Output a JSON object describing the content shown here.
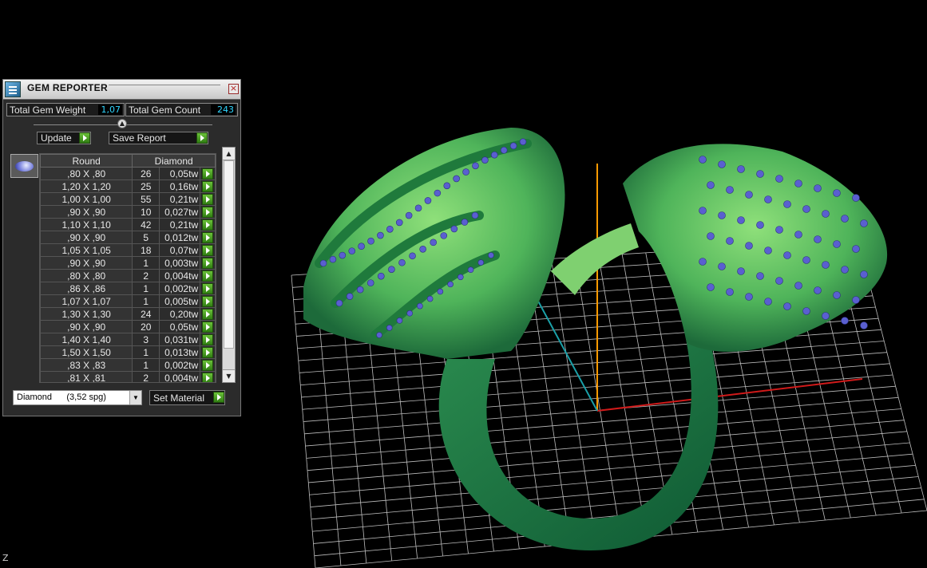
{
  "axis_label": "Z",
  "panel": {
    "title": "GEM REPORTER",
    "close_glyph": "×",
    "total_weight_label": "Total Gem Weight",
    "total_weight_value": "1,07",
    "total_count_label": "Total Gem Count",
    "total_count_value": "243",
    "update_label": "Update",
    "save_label": "Save Report",
    "table": {
      "col_shape": "Round",
      "col_material": "Diamond",
      "rows": [
        {
          "size": ",80 X ,80",
          "count": "26",
          "weight": "0,05tw"
        },
        {
          "size": "1,20 X 1,20",
          "count": "25",
          "weight": "0,16tw"
        },
        {
          "size": "1,00 X 1,00",
          "count": "55",
          "weight": "0,21tw"
        },
        {
          "size": ",90 X ,90",
          "count": "10",
          "weight": "0,027tw"
        },
        {
          "size": "1,10 X 1,10",
          "count": "42",
          "weight": "0,21tw"
        },
        {
          "size": ",90 X ,90",
          "count": "5",
          "weight": "0,012tw"
        },
        {
          "size": "1,05 X 1,05",
          "count": "18",
          "weight": "0,07tw"
        },
        {
          "size": ",90 X ,90",
          "count": "1",
          "weight": "0,003tw"
        },
        {
          "size": ",80 X ,80",
          "count": "2",
          "weight": "0,004tw"
        },
        {
          "size": ",86 X ,86",
          "count": "1",
          "weight": "0,002tw"
        },
        {
          "size": "1,07 X 1,07",
          "count": "1",
          "weight": "0,005tw"
        },
        {
          "size": "1,30 X 1,30",
          "count": "24",
          "weight": "0,20tw"
        },
        {
          "size": ",90 X ,90",
          "count": "20",
          "weight": "0,05tw"
        },
        {
          "size": "1,40 X 1,40",
          "count": "3",
          "weight": "0,031tw"
        },
        {
          "size": "1,50 X 1,50",
          "count": "1",
          "weight": "0,013tw"
        },
        {
          "size": ",83 X ,83",
          "count": "1",
          "weight": "0,002tw"
        },
        {
          "size": ",81 X ,81",
          "count": "2",
          "weight": "0,004tw"
        }
      ]
    },
    "material_select": "Diamond      (3,52 spg)",
    "set_material_label": "Set Material"
  },
  "colors": {
    "accent_green": "#4caf2c",
    "value_cyan": "#2fd6ff",
    "ring_green": "#3f9a52",
    "gem_blue": "#5a5fd0",
    "axis_x": "#d01a1a",
    "axis_y": "#1aa0a8",
    "axis_z": "#ff9a00"
  }
}
